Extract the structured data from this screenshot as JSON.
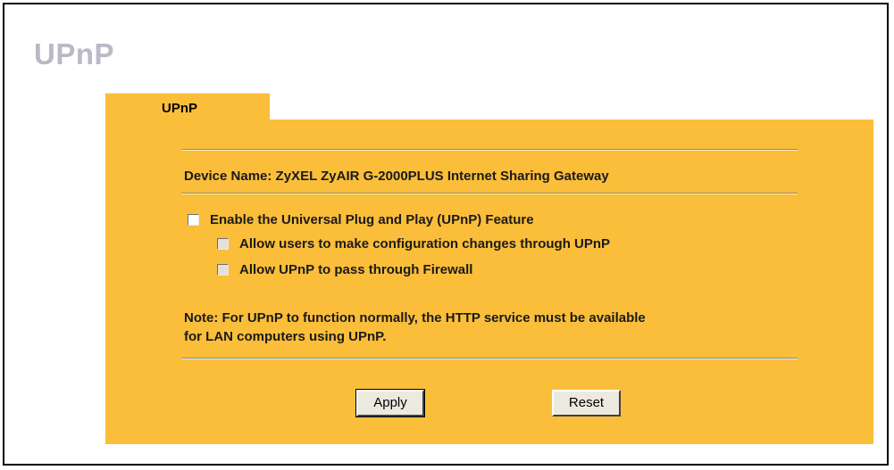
{
  "page": {
    "title": "UPnP"
  },
  "tab": {
    "label": "UPnP"
  },
  "device": {
    "text": "Device Name: ZyXEL ZyAIR G-2000PLUS Internet Sharing Gateway"
  },
  "options": [
    {
      "label": "Enable the Universal Plug and Play (UPnP) Feature",
      "checked": false,
      "enabled": true
    },
    {
      "label": "Allow users to make configuration changes through UPnP",
      "checked": false,
      "enabled": false
    },
    {
      "label": "Allow UPnP to pass through Firewall",
      "checked": false,
      "enabled": false
    }
  ],
  "note": {
    "line1": "Note: For UPnP to function normally, the HTTP service must be available",
    "line2": "for LAN computers using UPnP."
  },
  "buttons": {
    "apply_label": "Apply",
    "reset_label": "Reset"
  },
  "colors": {
    "panel": "#fbbe3a",
    "title": "#b9b9c7",
    "button_face": "#ece9df"
  }
}
